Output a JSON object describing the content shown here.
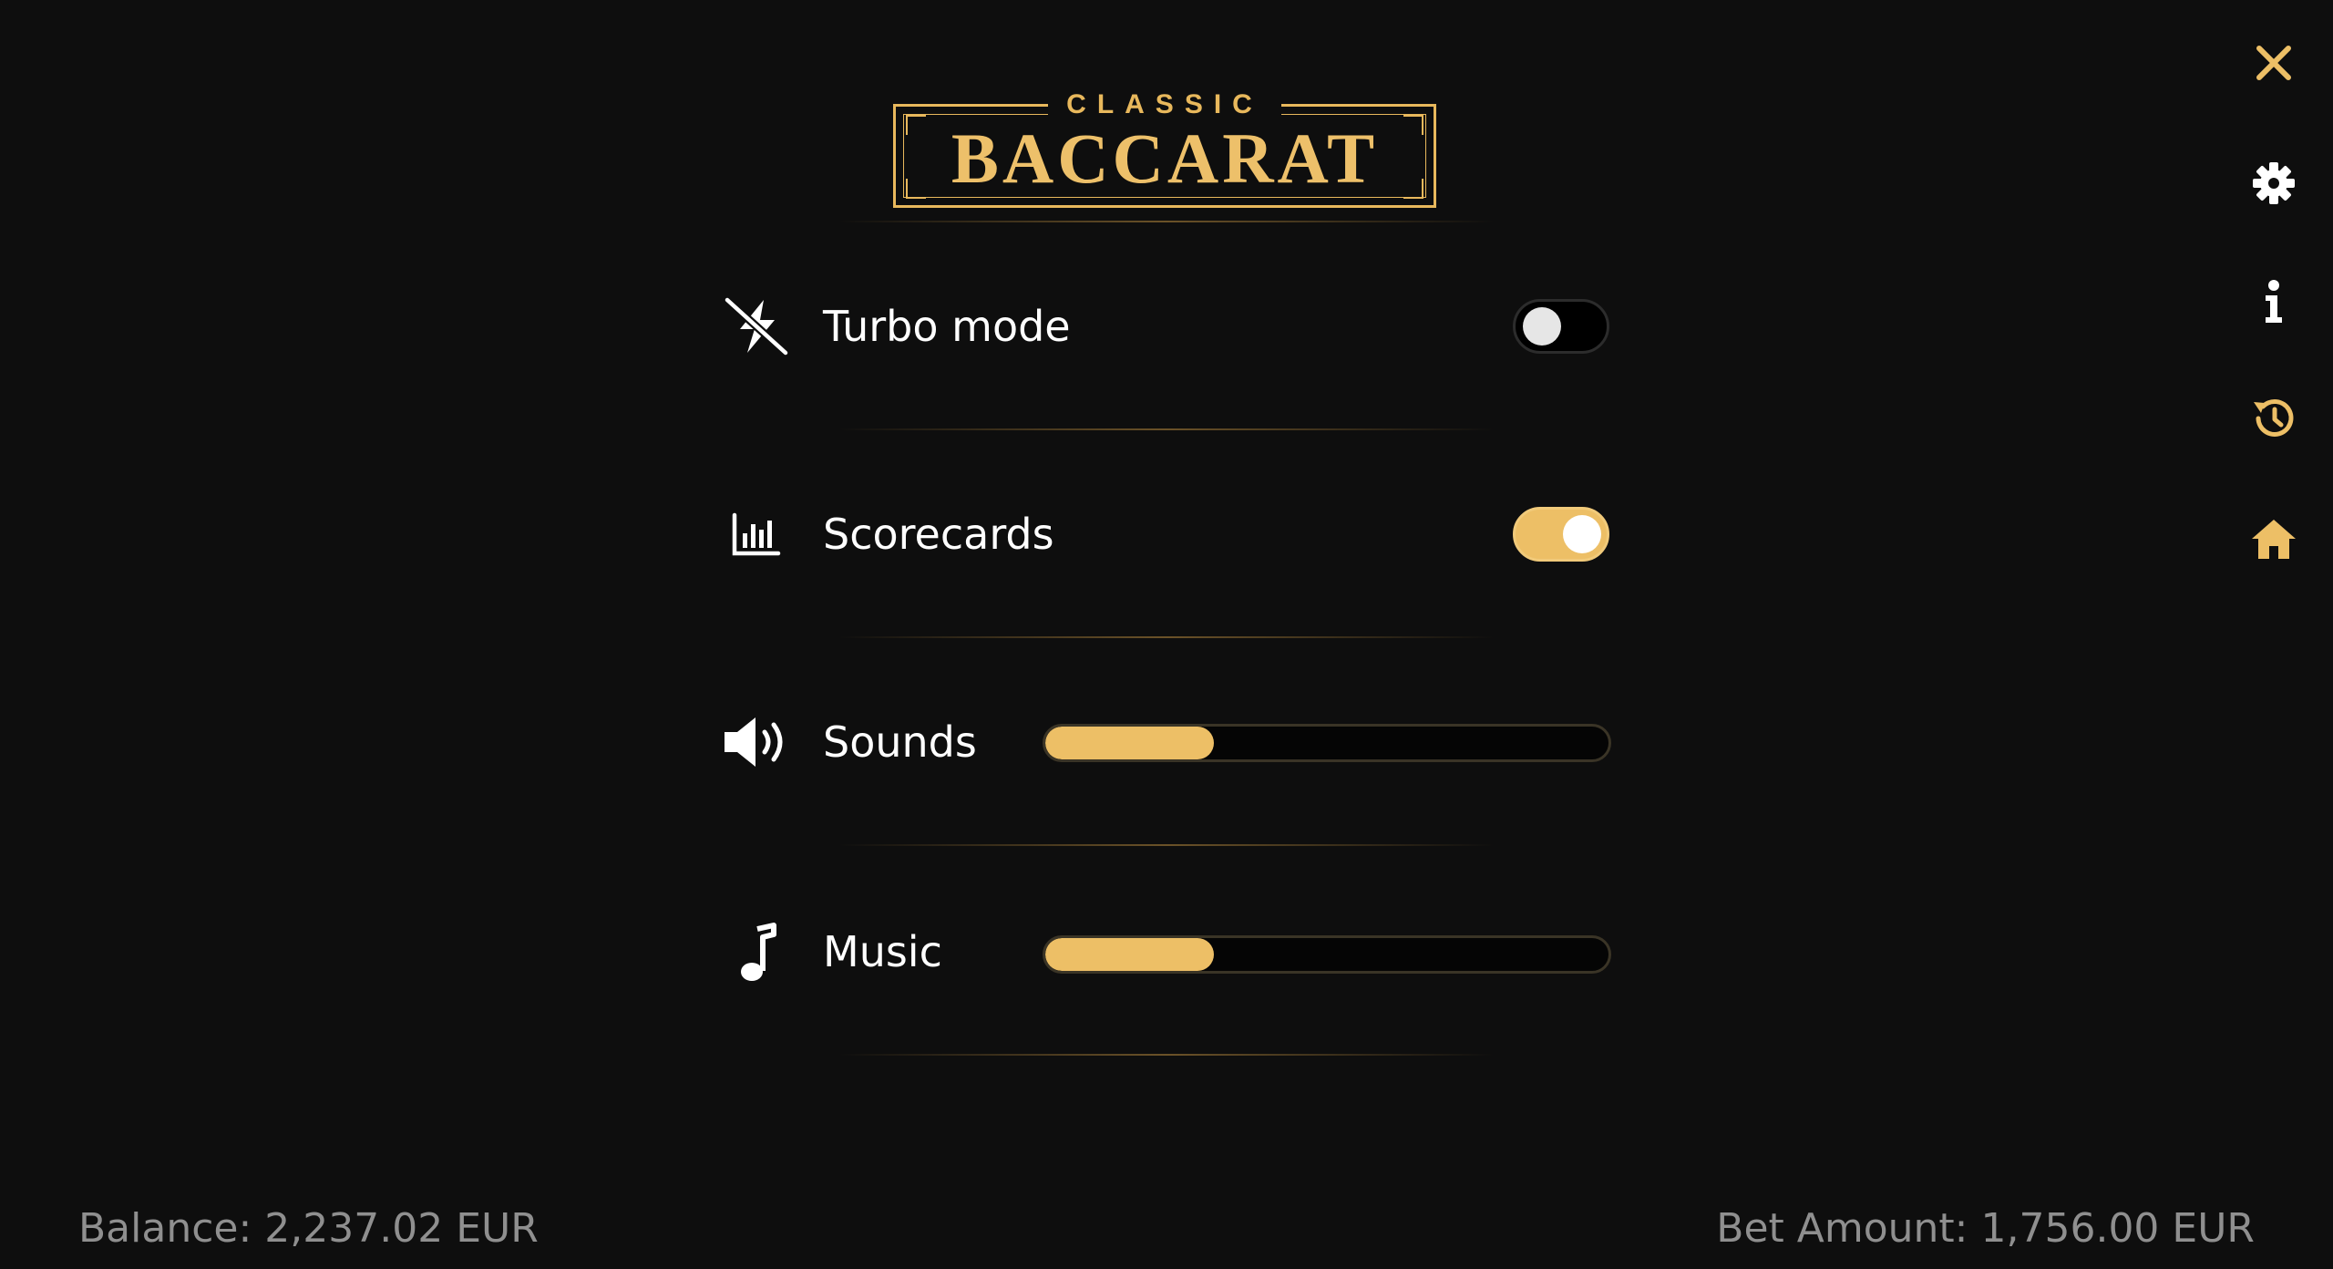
{
  "logo": {
    "top_text": "CLASSIC",
    "main_text": "BACCARAT"
  },
  "settings": {
    "turbo": {
      "label": "Turbo mode",
      "icon": "turbo-off-icon",
      "enabled": false
    },
    "scorecards": {
      "label": "Scorecards",
      "icon": "bar-chart-icon",
      "enabled": true
    },
    "sounds": {
      "label": "Sounds",
      "icon": "speaker-icon",
      "level": 0.3
    },
    "music": {
      "label": "Music",
      "icon": "music-note-icon",
      "level": 0.3
    }
  },
  "sidebar": {
    "items": [
      "close-icon",
      "gear-icon",
      "info-icon",
      "history-icon",
      "home-icon"
    ]
  },
  "footer": {
    "balance": "Balance: 2,237.02 EUR",
    "bet_amount": "Bet Amount: 1,756.00 EUR"
  },
  "colors": {
    "accent": "#edbf66",
    "background": "#0e0e0e",
    "text": "#ffffff",
    "muted_text": "#8f8f8f"
  }
}
